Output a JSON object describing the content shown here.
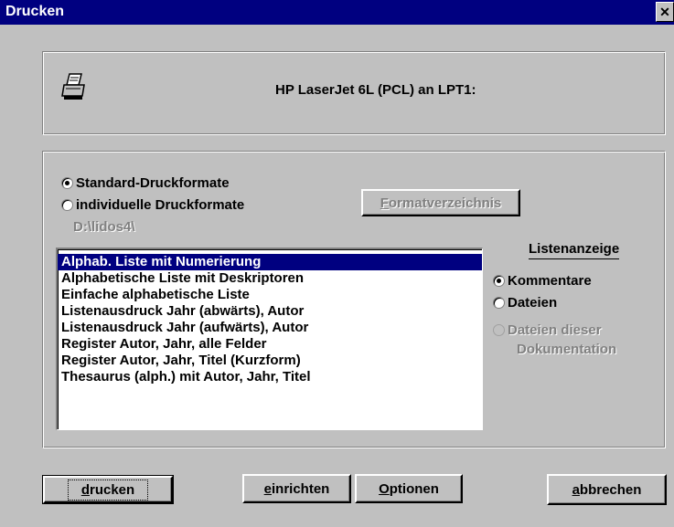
{
  "window": {
    "title": "Drucken",
    "close_glyph": "✕"
  },
  "printer": {
    "icon": "printer-icon",
    "name": "HP LaserJet 6L (PCL) an LPT1:"
  },
  "format_options": {
    "standard": "Standard-Druckformate",
    "individual": "individuelle Druckformate",
    "selected": "standard"
  },
  "format_directory_button": {
    "accel": "F",
    "rest": "ormatverzeichnis",
    "enabled": false
  },
  "path_label": "D:\\lidos4\\",
  "list": {
    "items": [
      "Alphab. Liste mit Numerierung",
      "Alphabetische Liste mit Deskriptoren",
      "Einfache alphabetische Liste",
      "Listenausdruck Jahr (abwärts), Autor",
      "Listenausdruck Jahr (aufwärts), Autor",
      "Register Autor, Jahr, alle Felder",
      "Register Autor, Jahr, Titel (Kurzform)",
      "Thesaurus (alph.) mit Autor, Jahr, Titel"
    ],
    "selected_index": 0
  },
  "listenanzeige": {
    "title": "Listenanzeige",
    "kommentare": "Kommentare",
    "dateien": "Dateien",
    "dateien_dieser": "Dateien dieser",
    "dokumentation": "Dokumentation",
    "selected": "kommentare"
  },
  "buttons": {
    "drucken": {
      "accel": "d",
      "rest": "rucken"
    },
    "einrichten": {
      "accel": "e",
      "rest": "inrichten"
    },
    "optionen": {
      "accel": "O",
      "rest": "ptionen"
    },
    "abbrechen": {
      "accel": "a",
      "rest": "bbrechen"
    }
  }
}
